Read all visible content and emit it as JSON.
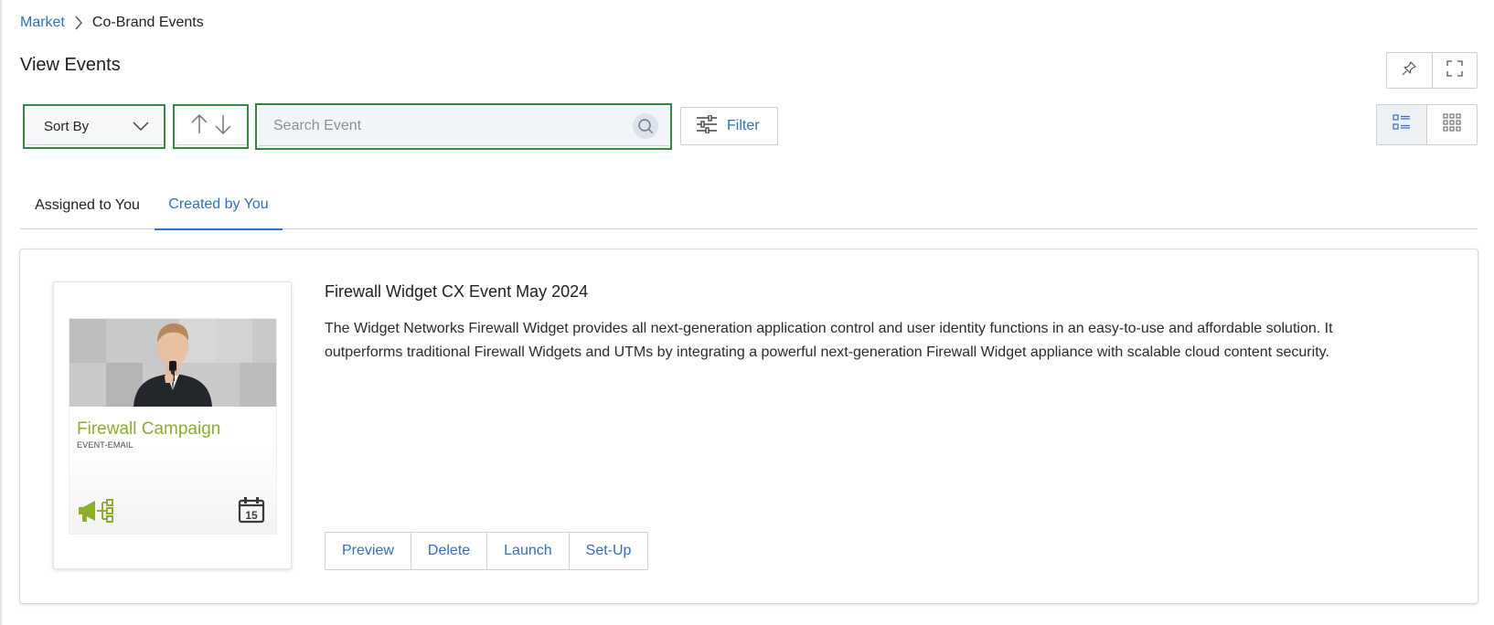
{
  "breadcrumb": {
    "root": "Market",
    "current": "Co-Brand Events"
  },
  "page": {
    "title": "View Events"
  },
  "toolbar": {
    "sort_label": "Sort By",
    "search_placeholder": "Search Event",
    "search_value": "",
    "filter_label": "Filter",
    "view_mode": "list"
  },
  "tabs": [
    {
      "label": "Assigned to You",
      "active": false
    },
    {
      "label": "Created by You",
      "active": true
    }
  ],
  "events": [
    {
      "title": "Firewall Widget CX Event May 2024",
      "description": "The Widget Networks Firewall Widget provides all next-generation application control and user identity functions in an easy-to-use and affordable solution. It outperforms traditional Firewall Widgets and UTMs by integrating a powerful next-generation Firewall Widget appliance with scalable cloud content security.",
      "thumbnail": {
        "title": "Firewall Campaign",
        "subtitle": "EVENT-EMAIL",
        "calendar_day": "15"
      },
      "actions": [
        "Preview",
        "Delete",
        "Launch",
        "Set-Up"
      ]
    }
  ],
  "icons": {
    "breadcrumb_separator": "chevron-right-icon",
    "pin": "pin-icon",
    "fullscreen": "fullscreen-icon",
    "sort_direction": "sort-arrows-icon",
    "search": "search-icon",
    "filter": "filter-sliders-icon",
    "list_view": "list-view-icon",
    "grid_view": "grid-view-icon",
    "campaign": "megaphone-network-icon",
    "calendar": "calendar-icon"
  },
  "colors": {
    "accent": "#2f6fcb",
    "highlight_border": "#2e8b3f",
    "campaign_green": "#8cae2b"
  }
}
